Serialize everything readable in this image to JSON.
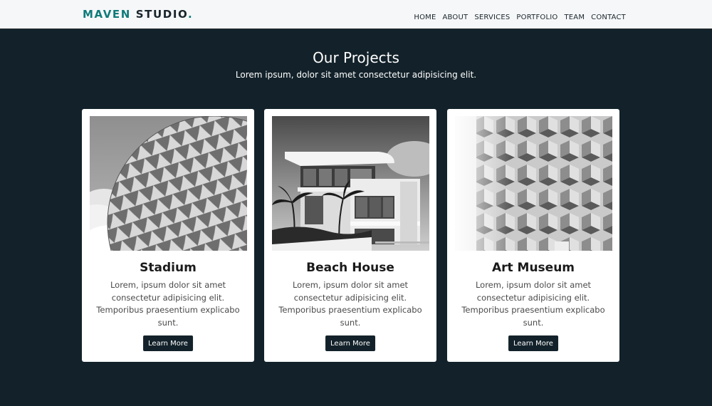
{
  "brand": {
    "part1": "MAVEN",
    "part2": " STUDIO",
    "dot": ".",
    "accent_color": "#0f7b7a"
  },
  "nav": [
    "HOME",
    "ABOUT",
    "SERVICES",
    "PORTFOLIO",
    "TEAM",
    "CONTACT"
  ],
  "projects_section": {
    "title": "Our Projects",
    "subtitle": "Lorem ipsum, dolor sit amet consectetur adipisicing elit.",
    "background_color": "#13222a"
  },
  "cards": [
    {
      "title": "Stadium",
      "text": "Lorem, ipsum dolor sit amet consectetur adipisicing elit. Temporibus praesentium explicabo sunt.",
      "button": "Learn More",
      "image": "geodesic-sphere-photo"
    },
    {
      "title": "Beach House",
      "text": "Lorem, ipsum dolor sit amet consectetur adipisicing elit. Temporibus praesentium explicabo sunt.",
      "button": "Learn More",
      "image": "modern-house-photo"
    },
    {
      "title": "Art Museum",
      "text": "Lorem, ipsum dolor sit amet consectetur adipisicing elit. Temporibus praesentium explicabo sunt.",
      "button": "Learn More",
      "image": "honeycomb-facade-photo"
    }
  ]
}
